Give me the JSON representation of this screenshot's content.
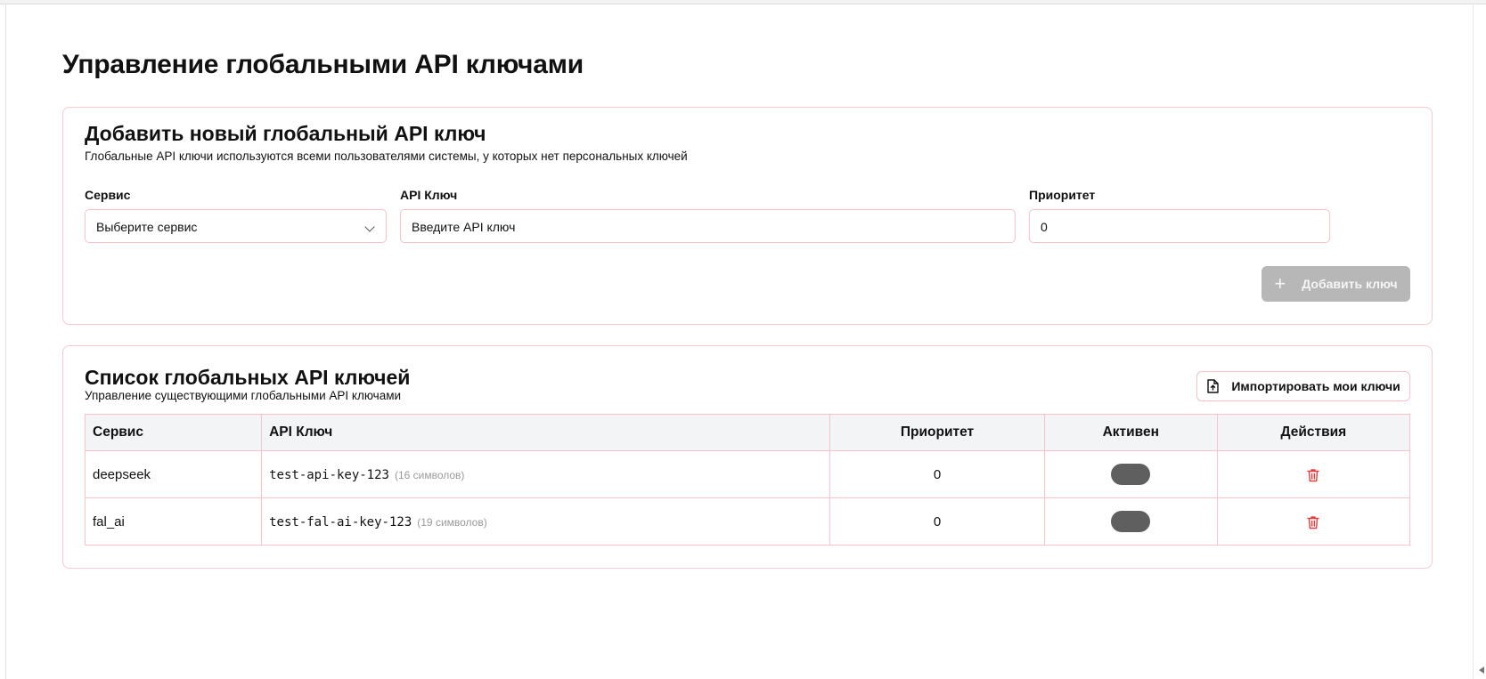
{
  "page": {
    "title": "Управление глобальными API ключами"
  },
  "add_card": {
    "title": "Добавить новый глобальный API ключ",
    "subtitle": "Глобальные API ключи используются всеми пользователями системы, у которых нет персональных ключей",
    "service": {
      "label": "Сервис",
      "value": "Выберите сервис"
    },
    "api_key": {
      "label": "API Ключ",
      "placeholder": "Введите API ключ"
    },
    "priority": {
      "label": "Приоритет",
      "value": "0"
    },
    "add_button": "Добавить ключ"
  },
  "list_card": {
    "title": "Список глобальных API ключей",
    "subtitle": "Управление существующими глобальными API ключами",
    "import_button": "Импортировать мои ключи",
    "columns": [
      "Сервис",
      "API Ключ",
      "Приоритет",
      "Активен",
      "Действия"
    ],
    "rows": [
      {
        "service": "deepseek",
        "key": "test-api-key-123",
        "length": "(16 символов)",
        "priority": "0"
      },
      {
        "service": "fal_ai",
        "key": "test-fal-ai-key-123",
        "length": "(19 символов)",
        "priority": "0"
      }
    ]
  },
  "colors": {
    "border": "#f4c3cc",
    "delete": "#e53e3e",
    "toggle": "#5f5f5f",
    "disabled_button": "#b7b7b7"
  }
}
